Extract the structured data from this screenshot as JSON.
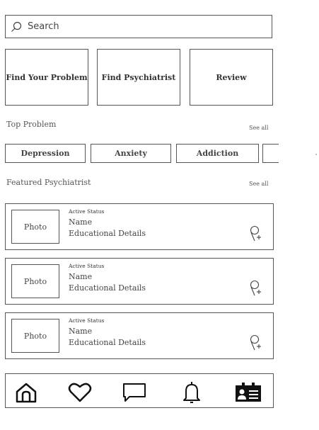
{
  "search": {
    "placeholder": "Search",
    "icon": "search-icon"
  },
  "categories": [
    {
      "label": "Find Your Problem"
    },
    {
      "label": "Find Psychiatrist"
    },
    {
      "label": "Review"
    }
  ],
  "top_problem": {
    "title": "Top Problem",
    "see_all": "See all",
    "chips": [
      "Depression",
      "Anxiety",
      "Addiction",
      ""
    ]
  },
  "featured": {
    "title": "Featured Psychiatrist",
    "see_all": "See all",
    "cards": [
      {
        "photo": "Photo",
        "status": "Active Status",
        "name": "Name",
        "education": "Educational Details",
        "action_icon": "add-person-icon"
      },
      {
        "photo": "Photo",
        "status": "Active Status",
        "name": "Name",
        "education": "Educational Details",
        "action_icon": "add-person-icon"
      },
      {
        "photo": "Photo",
        "status": "Active Status",
        "name": "Name",
        "education": "Educational Details",
        "action_icon": "add-person-icon"
      }
    ]
  },
  "bottom_nav": {
    "items": [
      {
        "icon": "home-icon"
      },
      {
        "icon": "heart-icon"
      },
      {
        "icon": "chat-icon"
      },
      {
        "icon": "bell-icon"
      },
      {
        "icon": "profile-card-icon"
      }
    ]
  }
}
